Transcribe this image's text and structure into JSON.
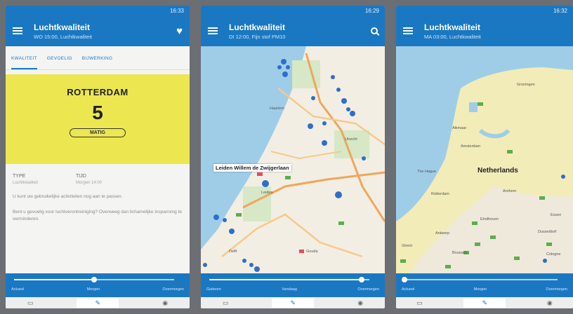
{
  "screen1": {
    "status_time": "16:33",
    "title": "Luchtkwaliteit",
    "subtitle": "WO 15:00, Luchtkwaliteit",
    "tabs": [
      "KWALITEIT",
      "GEVOELIG",
      "BIJWERKING"
    ],
    "city": "ROTTERDAM",
    "value": "5",
    "level": "MATIG",
    "type_label": "TYPE",
    "type_value": "Luchtkwaliteit",
    "time_label": "TIJD",
    "time_value": "Morgen 14:00",
    "para1": "U kunt uw gebruikelijke activiteiten nog aan te passen.",
    "para2": "Bent u gevoelig voor luchtverontreiniging? Overweeg dan lichamelijke inspanning te verminderen.",
    "slider_value": 0.5,
    "slider_labels": [
      "Actueel",
      "Morgen",
      "Overmorgen"
    ]
  },
  "screen2": {
    "status_time": "16:29",
    "title": "Luchtkwaliteit",
    "subtitle": "DI 12:00, Fijn stof PM10",
    "popup": "Leiden Willem de Zwijgerlaan",
    "place_labels": [
      "Haarlem",
      "Leiden",
      "Delft",
      "Gouda",
      "Utrecht"
    ],
    "slider_value": 0.95,
    "slider_labels": [
      "Gisteren",
      "Vandaag",
      "Overmorgen"
    ]
  },
  "screen3": {
    "status_time": "16:32",
    "title": "Luchtkwaliteit",
    "subtitle": "MA 03:00, Luchtkwaliteit",
    "country": "Netherlands",
    "place_labels": [
      "Groningen",
      "Alkmaar",
      "Amsterdam",
      "The Hague",
      "Rotterdam",
      "Arnhem",
      "Eindhoven",
      "Antwerp",
      "Brussels",
      "Ghent",
      "Dusseldorf",
      "Essen",
      "Cologne"
    ],
    "slider_value": 0.0,
    "slider_labels": [
      "Actueel",
      "Morgen",
      "Overmorgen"
    ]
  },
  "nav": [
    "▭",
    "✎",
    "◉"
  ],
  "colors": {
    "primary": "#1a78c2",
    "aq_moderate": "#ece651",
    "station_dot": "#2d6fc9"
  }
}
